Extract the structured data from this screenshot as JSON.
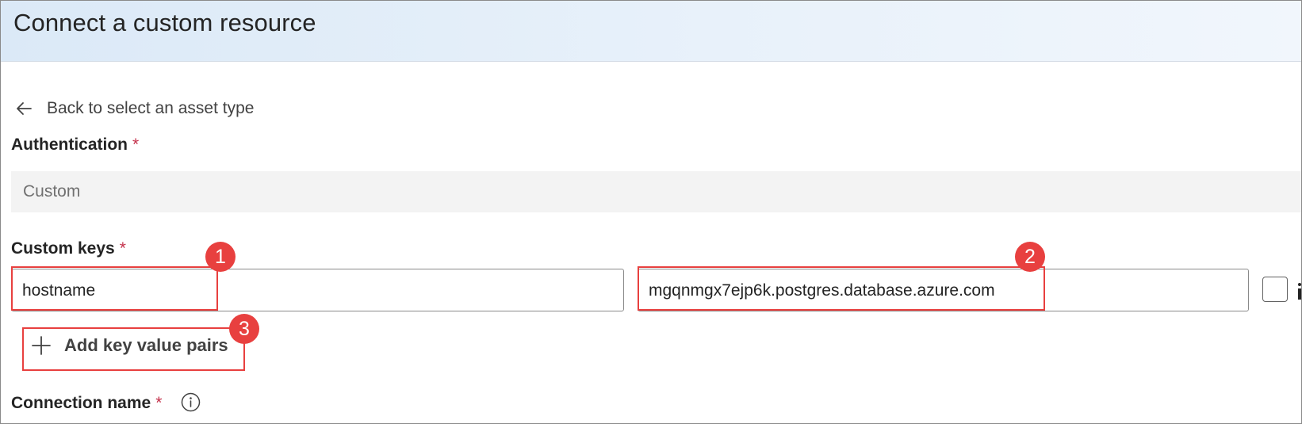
{
  "header": {
    "title": "Connect a custom resource"
  },
  "back_link": {
    "label": "Back to select an asset type",
    "icon": "arrow-left-icon"
  },
  "authentication": {
    "label": "Authentication",
    "required_mark": "*",
    "value": "Custom"
  },
  "custom_keys": {
    "label": "Custom keys",
    "required_mark": "*",
    "key_value": "hostname",
    "value_value": "mgqnmgx7ejp6k.postgres.database.azure.com",
    "add_pairs_label": "Add key value pairs"
  },
  "connection_name": {
    "label": "Connection name",
    "required_mark": "*",
    "info_icon": "info-icon"
  },
  "annotations": {
    "badge_1": "1",
    "badge_2": "2",
    "badge_3": "3"
  },
  "colors": {
    "highlight": "#e8403f",
    "required": "#c4314b",
    "header_gradient_start": "#dbe9f7"
  }
}
